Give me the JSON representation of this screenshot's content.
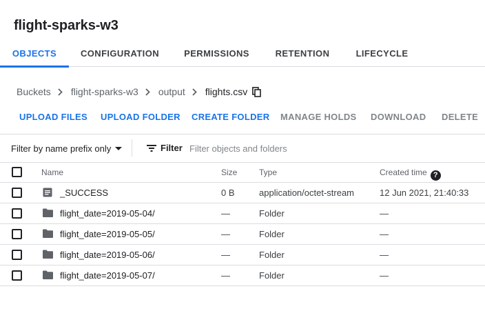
{
  "page_title": "flight-sparks-w3",
  "tabs": [
    {
      "label": "OBJECTS",
      "active": true
    },
    {
      "label": "CONFIGURATION",
      "active": false
    },
    {
      "label": "PERMISSIONS",
      "active": false
    },
    {
      "label": "RETENTION",
      "active": false
    },
    {
      "label": "LIFECYCLE",
      "active": false
    }
  ],
  "breadcrumb": [
    "Buckets",
    "flight-sparks-w3",
    "output",
    "flights.csv"
  ],
  "actions": [
    {
      "label": "UPLOAD FILES",
      "enabled": true
    },
    {
      "label": "UPLOAD FOLDER",
      "enabled": true
    },
    {
      "label": "CREATE FOLDER",
      "enabled": true
    },
    {
      "label": "MANAGE HOLDS",
      "enabled": false
    },
    {
      "label": "DOWNLOAD",
      "enabled": false
    },
    {
      "label": "DELETE",
      "enabled": false
    }
  ],
  "filter": {
    "prefix_label": "Filter by name prefix only",
    "label": "Filter",
    "placeholder": "Filter objects and folders"
  },
  "table": {
    "columns": {
      "name": "Name",
      "size": "Size",
      "type": "Type",
      "created": "Created time"
    },
    "rows": [
      {
        "icon": "file-icon",
        "name": "_SUCCESS",
        "size": "0 B",
        "type": "application/octet-stream",
        "created": "12 Jun 2021, 21:40:33"
      },
      {
        "icon": "folder-icon",
        "name": "flight_date=2019-05-04/",
        "size": "—",
        "type": "Folder",
        "created": "—"
      },
      {
        "icon": "folder-icon",
        "name": "flight_date=2019-05-05/",
        "size": "—",
        "type": "Folder",
        "created": "—"
      },
      {
        "icon": "folder-icon",
        "name": "flight_date=2019-05-06/",
        "size": "—",
        "type": "Folder",
        "created": "—"
      },
      {
        "icon": "folder-icon",
        "name": "flight_date=2019-05-07/",
        "size": "—",
        "type": "Folder",
        "created": "—"
      }
    ]
  },
  "colors": {
    "accent": "#1a73e8",
    "disabled": "#80868b",
    "divider": "#dadce0",
    "text": "#202124"
  }
}
